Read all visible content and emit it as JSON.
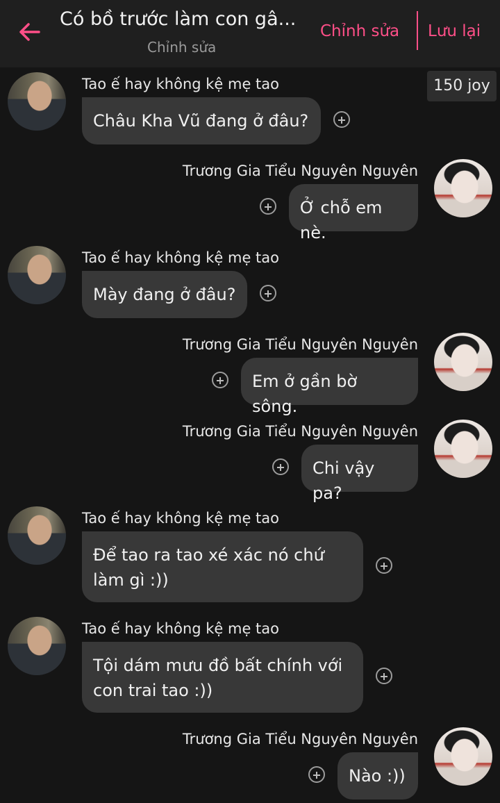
{
  "header": {
    "title": "Có bồ trước làm con gâ...",
    "subtitle": "Chỉnh sửa",
    "edit_label": "Chỉnh sửa",
    "save_label": "Lưu lại",
    "accent_color": "#ff4f88"
  },
  "joy_badge": "150 joy",
  "messages": [
    {
      "sender": "Tao ế hay không kệ mẹ tao",
      "text": [
        "Châu Kha Vũ đang ở đâu?"
      ]
    },
    {
      "sender": "Trương Gia Tiểu Nguyên Nguyên",
      "text": [
        "Ở chỗ em nè."
      ]
    },
    {
      "sender": "Tao ế hay không kệ mẹ tao",
      "text": [
        "Mày đang ở đâu?"
      ]
    },
    {
      "sender": "Trương Gia Tiểu Nguyên Nguyên",
      "text": [
        "Em ở gần bờ sông."
      ]
    },
    {
      "sender": "Trương Gia Tiểu Nguyên Nguyên",
      "text": [
        "Chi vậy pa?"
      ]
    },
    {
      "sender": "Tao ế hay không kệ mẹ tao",
      "text": [
        "Để tao ra tao xé xác nó chứ",
        "làm gì :))"
      ]
    },
    {
      "sender": "Tao ế hay không kệ mẹ tao",
      "text": [
        "Tội dám mưu đồ bất chính với",
        "con trai tao :))"
      ]
    },
    {
      "sender": "Trương Gia Tiểu Nguyên Nguyên",
      "text": [
        "Nào :))"
      ]
    }
  ]
}
